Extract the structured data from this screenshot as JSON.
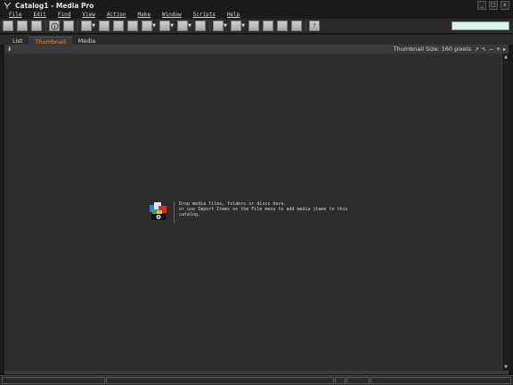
{
  "window": {
    "title": "Catalog1 - Media Pro",
    "controls": [
      "_",
      "□",
      "x"
    ]
  },
  "menu": [
    {
      "label": "File"
    },
    {
      "label": "Edit"
    },
    {
      "label": "Find"
    },
    {
      "label": "View"
    },
    {
      "label": "Action"
    },
    {
      "label": "Make"
    },
    {
      "label": "Window"
    },
    {
      "label": "Scripts"
    },
    {
      "label": "Help"
    }
  ],
  "toolbar": {
    "search_value": ""
  },
  "tabs": [
    {
      "label": "List",
      "active": false
    },
    {
      "label": "Thumbnail",
      "active": true
    },
    {
      "label": "Media",
      "active": false
    }
  ],
  "infobar": {
    "thumbnail_size": "Thumbnail Size: 160 pixels"
  },
  "drop_hint": {
    "line1": "Drop media files, folders or discs here,",
    "line2": "or use Import Items on the File menu to add media items to this catalog."
  },
  "colors": {
    "accent_tab": "#ef8e3a",
    "search_bg": "#d9f5e6"
  }
}
